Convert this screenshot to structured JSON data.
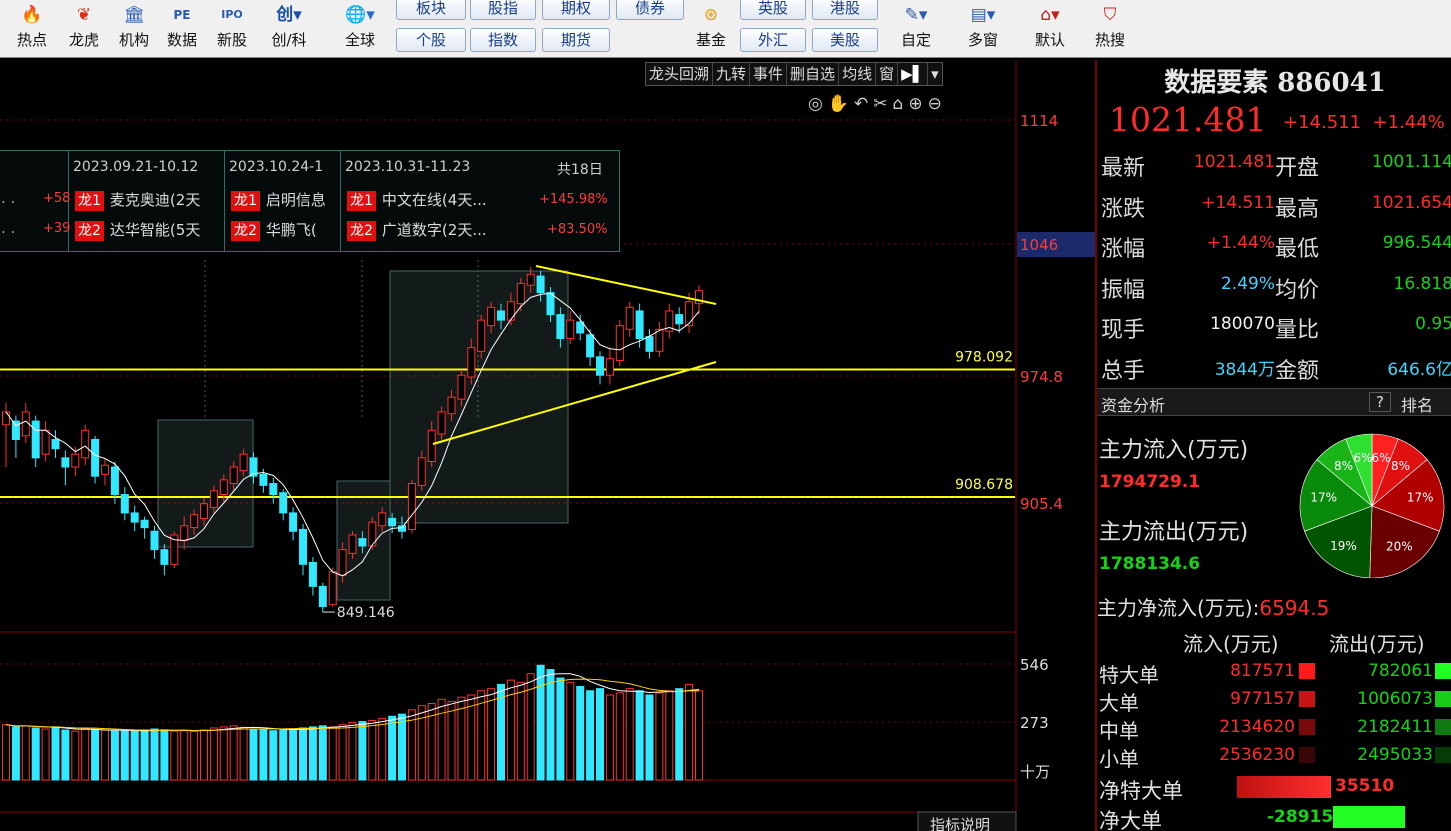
{
  "toolbar": {
    "tools": [
      {
        "label": "热点",
        "icon": "hot-icon"
      },
      {
        "label": "龙虎",
        "icon": "dragon-tiger-icon"
      },
      {
        "label": "机构",
        "icon": "institution-icon"
      },
      {
        "label": "数据",
        "icon": "pe-data-icon"
      },
      {
        "label": "新股",
        "icon": "ipo-icon"
      },
      {
        "label": "创/科",
        "icon": "chuang-icon"
      },
      {
        "label": "全球",
        "icon": "globe-icon"
      },
      {
        "label": "基金",
        "icon": "fund-icon"
      },
      {
        "label": "自定",
        "icon": "custom-icon"
      },
      {
        "label": "多窗",
        "icon": "multi-window-icon"
      },
      {
        "label": "默认",
        "icon": "home-icon"
      },
      {
        "label": "热搜",
        "icon": "hot-search-icon"
      }
    ],
    "buttons": {
      "bankuai": "板块",
      "gegu": "个股",
      "guzhi": "股指",
      "zhishu": "指数",
      "qiquan": "期权",
      "qihuo": "期货",
      "zhaiquan": "债券",
      "yinggu": "英股",
      "waihui": "外汇",
      "ganggu": "港股",
      "meigu": "美股"
    }
  },
  "mini_menu": [
    "龙头回溯",
    "九转",
    "事件",
    "删自选",
    "均线",
    "窗"
  ],
  "dragon_board": {
    "periods": [
      {
        "range": "2023.09.21-10.12",
        "dragon1": "麦克奥迪(2天",
        "dragon2": "达华智能(5天"
      },
      {
        "range": "2023.10.24-1",
        "dragon1": "启明信息",
        "dragon2": "华鹏飞("
      },
      {
        "range": "2023.10.31-11.23",
        "total": "共18日",
        "dragon1": "中文在线(4天...",
        "dragon1_pct": "+145.98%",
        "dragon2": "广道数字(2天...",
        "dragon2_pct": "+83.50%"
      }
    ],
    "left_partial": [
      "+58",
      "+39"
    ],
    "tag1": "龙1",
    "tag2": "龙2"
  },
  "chart_data": {
    "type": "candlestick",
    "price_axis_labels": [
      "1114",
      "1046",
      "974.8",
      "905.4"
    ],
    "volume_axis_labels": [
      "546",
      "273",
      "十万"
    ],
    "hlines": [
      {
        "value": 978.092,
        "label": "978.092"
      },
      {
        "value": 908.678,
        "label": "908.678"
      }
    ],
    "low_marker": "849.146",
    "bottom_button": "指标说明",
    "candles": [
      [
        948,
        955,
        925,
        960
      ],
      [
        950,
        940,
        930,
        953
      ],
      [
        942,
        955,
        938,
        960
      ],
      [
        950,
        930,
        925,
        953
      ],
      [
        932,
        945,
        928,
        950
      ],
      [
        940,
        935,
        930,
        945
      ],
      [
        930,
        925,
        915,
        934
      ],
      [
        925,
        932,
        920,
        936
      ],
      [
        930,
        945,
        926,
        948
      ],
      [
        940,
        920,
        916,
        942
      ],
      [
        921,
        926,
        915,
        930
      ],
      [
        925,
        910,
        905,
        928
      ],
      [
        910,
        900,
        896,
        914
      ],
      [
        900,
        895,
        890,
        904
      ],
      [
        896,
        892,
        886,
        898
      ],
      [
        890,
        880,
        875,
        893
      ],
      [
        880,
        872,
        866,
        883
      ],
      [
        872,
        888,
        870,
        890
      ],
      [
        885,
        893,
        880,
        898
      ],
      [
        892,
        899,
        888,
        902
      ],
      [
        897,
        905,
        893,
        908
      ],
      [
        903,
        912,
        900,
        915
      ],
      [
        910,
        918,
        906,
        921
      ],
      [
        916,
        925,
        912,
        928
      ],
      [
        923,
        932,
        920,
        935
      ],
      [
        930,
        920,
        916,
        933
      ],
      [
        921,
        915,
        911,
        924
      ],
      [
        916,
        910,
        905,
        919
      ],
      [
        911,
        900,
        896,
        913
      ],
      [
        900,
        890,
        885,
        903
      ],
      [
        891,
        872,
        866,
        894
      ],
      [
        873,
        860,
        855,
        876
      ],
      [
        860,
        849,
        846,
        862
      ],
      [
        850,
        868,
        849,
        870
      ],
      [
        866,
        880,
        862,
        884
      ],
      [
        878,
        888,
        875,
        890
      ],
      [
        886,
        882,
        878,
        890
      ],
      [
        882,
        895,
        880,
        898
      ],
      [
        893,
        900,
        890,
        903
      ],
      [
        897,
        893,
        889,
        900
      ],
      [
        893,
        890,
        886,
        898
      ],
      [
        891,
        916,
        889,
        918
      ],
      [
        915,
        930,
        912,
        934
      ],
      [
        928,
        945,
        925,
        950
      ],
      [
        943,
        955,
        940,
        958
      ],
      [
        954,
        963,
        950,
        967
      ],
      [
        962,
        975,
        958,
        978
      ],
      [
        974,
        990,
        970,
        995
      ],
      [
        988,
        1005,
        984,
        1008
      ],
      [
        1002,
        1012,
        998,
        1015
      ],
      [
        1010,
        1005,
        1000,
        1014
      ],
      [
        1005,
        1015,
        1002,
        1020
      ],
      [
        1014,
        1025,
        1010,
        1028
      ],
      [
        1024,
        1030,
        1020,
        1034
      ],
      [
        1029,
        1020,
        1015,
        1032
      ],
      [
        1020,
        1008,
        1004,
        1023
      ],
      [
        1008,
        995,
        990,
        1012
      ],
      [
        995,
        1005,
        992,
        1010
      ],
      [
        1004,
        998,
        994,
        1008
      ],
      [
        997,
        985,
        980,
        1000
      ],
      [
        985,
        975,
        970,
        988
      ],
      [
        975,
        984,
        970,
        990
      ],
      [
        983,
        1002,
        980,
        1005
      ],
      [
        1000,
        1012,
        996,
        1015
      ],
      [
        1010,
        995,
        990,
        1014
      ],
      [
        996,
        988,
        984,
        1000
      ],
      [
        988,
        1000,
        985,
        1004
      ],
      [
        999,
        1010,
        995,
        1014
      ],
      [
        1008,
        1003,
        998,
        1012
      ],
      [
        1002,
        1015,
        998,
        1020
      ],
      [
        1014,
        1021,
        1008,
        1024
      ]
    ],
    "volumes": [
      260,
      250,
      255,
      245,
      240,
      250,
      235,
      230,
      240,
      238,
      235,
      230,
      232,
      228,
      235,
      240,
      236,
      230,
      232,
      228,
      236,
      245,
      250,
      255,
      248,
      240,
      238,
      232,
      235,
      240,
      245,
      250,
      255,
      250,
      260,
      270,
      275,
      280,
      290,
      300,
      310,
      330,
      350,
      360,
      380,
      370,
      390,
      400,
      420,
      430,
      450,
      470,
      460,
      500,
      540,
      520,
      480,
      460,
      440,
      420,
      430,
      400,
      410,
      430,
      420,
      400,
      410,
      420,
      430,
      450,
      420
    ]
  },
  "right_panel": {
    "title": "数据要素 886041",
    "price": "1021.481",
    "change": "+14.511",
    "change_pct": "+1.44%",
    "quote": [
      {
        "l1": "最新",
        "v1": "1021.481",
        "c1": "red",
        "l2": "开盘",
        "v2": "1001.114",
        "c2": "green"
      },
      {
        "l1": "涨跌",
        "v1": "+14.511",
        "c1": "red",
        "l2": "最高",
        "v2": "1021.654",
        "c2": "red"
      },
      {
        "l1": "涨幅",
        "v1": "+1.44%",
        "c1": "red",
        "l2": "最低",
        "v2": "996.544",
        "c2": "green"
      },
      {
        "l1": "振幅",
        "v1": "2.49%",
        "c1": "cyan",
        "l2": "均价",
        "v2": "16.818",
        "c2": "green"
      },
      {
        "l1": "现手",
        "v1": "180070",
        "c1": "white",
        "l2": "量比",
        "v2": "0.95",
        "c2": "green"
      },
      {
        "l1": "总手",
        "v1": "3844万",
        "c1": "cyan",
        "l2": "金额",
        "v2": "646.6亿",
        "c2": "cyan"
      }
    ],
    "fund_analysis": "资金分析",
    "help": "?",
    "rank": "排名",
    "inflow_label": "主力流入(万元)",
    "inflow_value": "1794729.1",
    "outflow_label": "主力流出(万元)",
    "outflow_value": "1788134.6",
    "net_label": "主力净流入(万元):",
    "net_value": "6594.5",
    "pie": [
      {
        "pct": "6%",
        "color": "#ff2020"
      },
      {
        "pct": "8%",
        "color": "#e01010"
      },
      {
        "pct": "17%",
        "color": "#b00000"
      },
      {
        "pct": "20%",
        "color": "#6a0000"
      },
      {
        "pct": "19%",
        "color": "#005500"
      },
      {
        "pct": "17%",
        "color": "#0a8a0a"
      },
      {
        "pct": "8%",
        "color": "#18b418"
      },
      {
        "pct": "6%",
        "color": "#30e030"
      }
    ],
    "table_head_in": "流入(万元)",
    "table_head_out": "流出(万元)",
    "table": [
      {
        "name": "特大单",
        "in": "817571",
        "out": "782061"
      },
      {
        "name": "大单",
        "in": "977157",
        "out": "1006073"
      },
      {
        "name": "中单",
        "in": "2134620",
        "out": "2182411"
      },
      {
        "name": "小单",
        "in": "2536230",
        "out": "2495033"
      }
    ],
    "net_rows": [
      {
        "name": "净特大单",
        "value": "35510",
        "color": "red"
      },
      {
        "name": "净大单",
        "value": "-28915",
        "color": "green"
      }
    ]
  }
}
